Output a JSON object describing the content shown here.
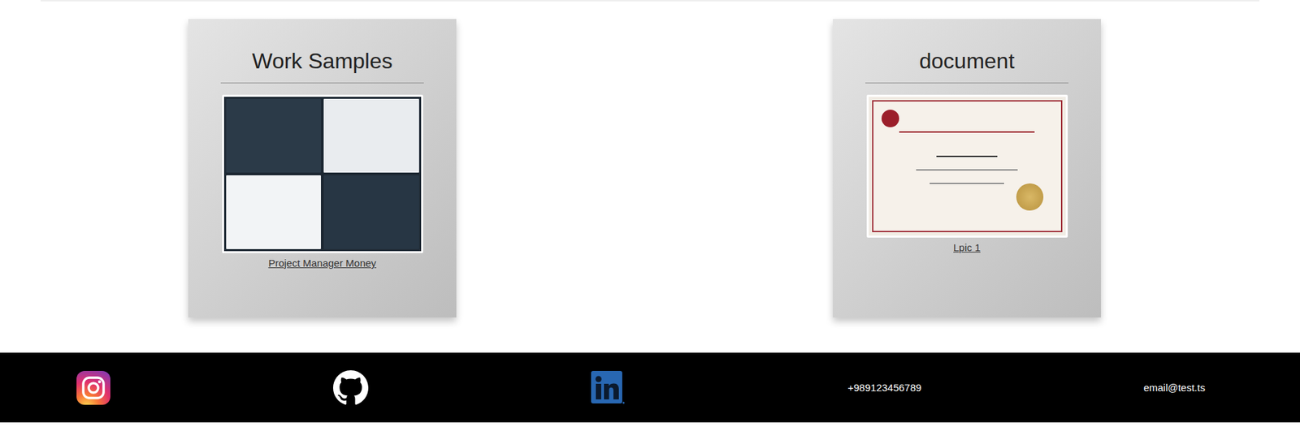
{
  "cards": [
    {
      "title": "Work Samples",
      "caption": "Project Manager Money",
      "kind": "screenshot"
    },
    {
      "title": "document",
      "caption": "Lpic 1",
      "kind": "certificate"
    }
  ],
  "footer": {
    "phone": "+989123456789",
    "email": "email@test.ts"
  }
}
